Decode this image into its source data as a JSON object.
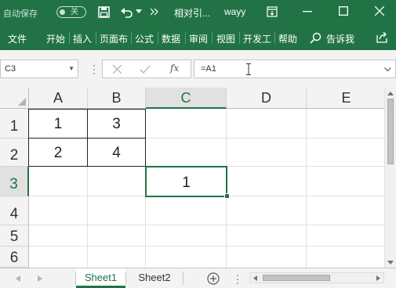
{
  "titlebar": {
    "autosave_label": "自动保存",
    "autosave_state": "关",
    "doc_title": "相对引...",
    "user": "wayy"
  },
  "ribbon": {
    "tabs": [
      "文件",
      "开始",
      "插入",
      "页面布",
      "公式",
      "数据",
      "审阅",
      "视图",
      "开发工",
      "帮助"
    ],
    "tell_me": "告诉我"
  },
  "formula_bar": {
    "name_box": "C3",
    "formula": "=A1",
    "fx": "fx"
  },
  "grid": {
    "columns": [
      "A",
      "B",
      "C",
      "D",
      "E"
    ],
    "rows": [
      "1",
      "2",
      "3",
      "4",
      "5",
      "6"
    ],
    "cells": {
      "A1": "1",
      "B1": "3",
      "A2": "2",
      "B2": "4",
      "C3": "1"
    },
    "selected_column": "C",
    "selected_row": "3"
  },
  "sheets": {
    "tabs": [
      "Sheet1",
      "Sheet2"
    ],
    "active": "Sheet1"
  },
  "colors": {
    "accent": "#217346"
  }
}
